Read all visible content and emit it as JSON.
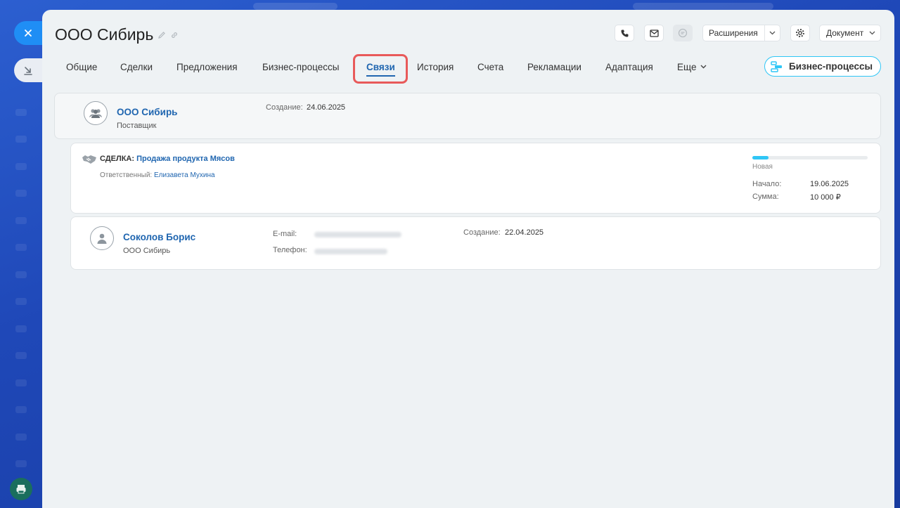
{
  "entity": {
    "title": "ООО Сибирь"
  },
  "toolbar": {
    "extensions_label": "Расширения",
    "document_label": "Документ"
  },
  "tabs": [
    {
      "label": "Общие"
    },
    {
      "label": "Сделки"
    },
    {
      "label": "Предложения"
    },
    {
      "label": "Бизнес-процессы"
    },
    {
      "label": "Связи",
      "active": true
    },
    {
      "label": "История"
    },
    {
      "label": "Счета"
    },
    {
      "label": "Рекламации"
    },
    {
      "label": "Адаптация"
    },
    {
      "label": "Еще"
    }
  ],
  "business_process_button": "Бизнес-процессы",
  "company_card": {
    "name": "ООО Сибирь",
    "type": "Поставщик",
    "created_label": "Создание:",
    "created_date": "24.06.2025"
  },
  "deal_card": {
    "prefix": "СДЕЛКА:",
    "name": "Продажа продукта Мясов",
    "responsible_label": "Ответственный:",
    "responsible_name": "Елизавета Мухина",
    "stage": "Новая",
    "stage_progress": 0.14,
    "start_label": "Начало:",
    "start_date": "19.06.2025",
    "sum_label": "Сумма:",
    "sum_value": "10 000 ₽"
  },
  "contact_card": {
    "name": "Соколов Борис",
    "company": "ООО Сибирь",
    "email_label": "E-mail:",
    "phone_label": "Телефон:",
    "created_label": "Создание:",
    "created_date": "22.04.2025"
  },
  "colors": {
    "accent": "#2066b0",
    "highlight": "#e85a5a",
    "progress": "#2fc6f6",
    "background_blue": "#1f48b8"
  }
}
